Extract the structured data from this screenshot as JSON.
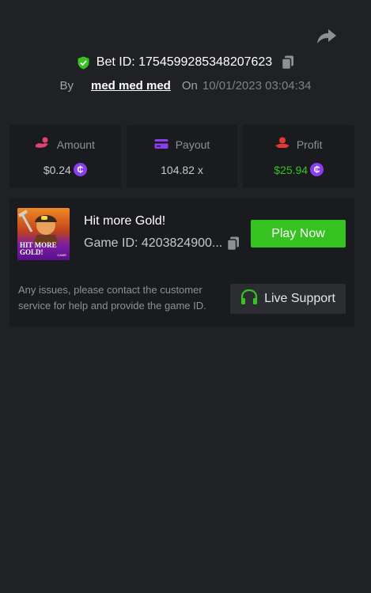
{
  "header": {
    "bet_id_label": "Bet ID: 1754599285348207623",
    "by_label": "By",
    "username": "med med med",
    "on_label": "On",
    "datetime": "10/01/2023 03:04:34"
  },
  "stats": {
    "amount": {
      "label": "Amount",
      "value": "$0.24",
      "icon": "hand-coins-icon"
    },
    "payout": {
      "label": "Payout",
      "value": "104.82 x",
      "icon": "card-icon"
    },
    "profit": {
      "label": "Profit",
      "value": "$25.94",
      "icon": "hand-money-icon"
    },
    "currency_glyph": "₵"
  },
  "game": {
    "title": "Hit more Gold!",
    "game_id": "Game ID: 4203824900...",
    "thumbnail_text": "HIT MORE\nGOLD!",
    "thumbnail_badge": "GAME",
    "play_label": "Play Now"
  },
  "support": {
    "note": "Any issues, please contact the customer service for help and provide the game ID.",
    "button_label": "Live Support"
  },
  "colors": {
    "background": "#202124",
    "card": "#1a1b1e",
    "accent_green": "#36c322",
    "coin_purple": "#8b3ef0",
    "amount_pink": "#e2436e",
    "payout_purple": "#8b3ef0",
    "profit_red": "#e23a32"
  }
}
